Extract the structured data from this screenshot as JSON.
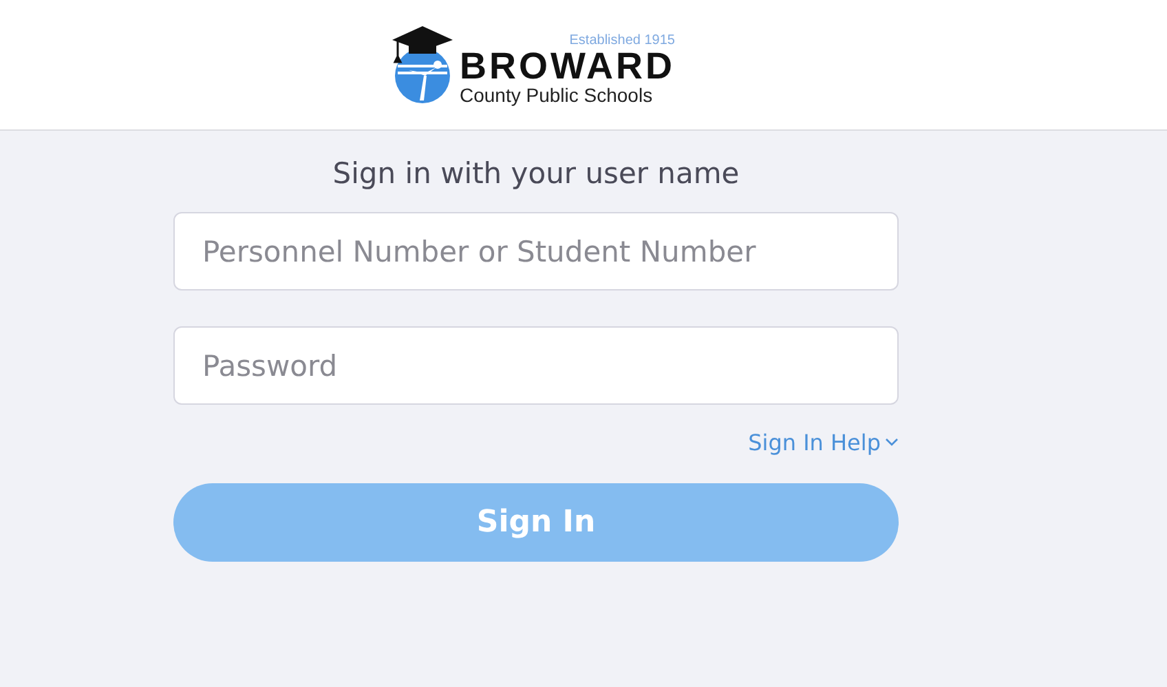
{
  "logo": {
    "established": "Established 1915",
    "name": "BROWARD",
    "subtitle": "County Public Schools"
  },
  "heading": "Sign in with your user name",
  "fields": [
    {
      "placeholder": "Personnel Number or Student Number"
    },
    {
      "placeholder": "Password"
    }
  ],
  "help_link": {
    "label": "Sign In Help",
    "expanded": false
  },
  "submit": {
    "label": "Sign In",
    "disabled": true
  }
}
